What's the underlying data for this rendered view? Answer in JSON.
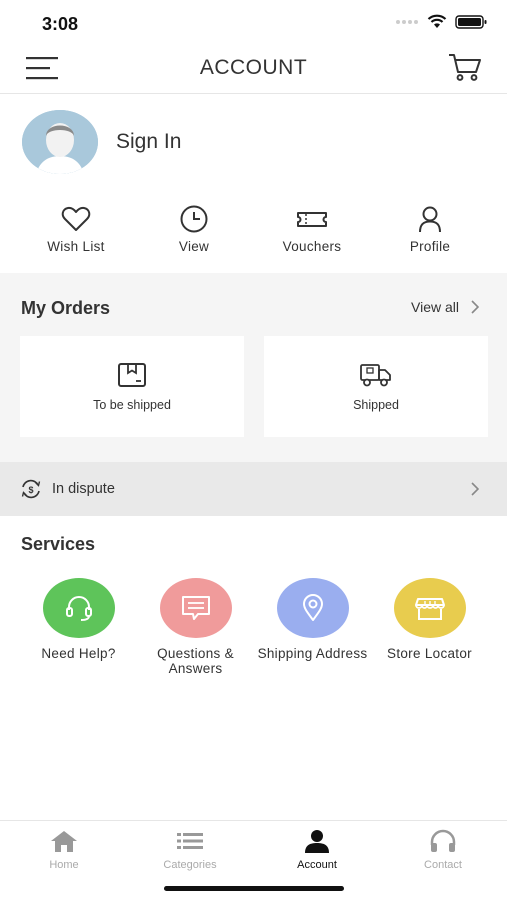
{
  "status_bar": {
    "time": "3:08"
  },
  "header": {
    "title": "ACCOUNT"
  },
  "profile": {
    "sign_in_label": "Sign In"
  },
  "quick_actions": [
    {
      "label": "Wish List",
      "icon": "heart-icon"
    },
    {
      "label": "View",
      "icon": "clock-icon"
    },
    {
      "label": "Vouchers",
      "icon": "ticket-icon"
    },
    {
      "label": "Profile",
      "icon": "person-icon"
    }
  ],
  "orders": {
    "title": "My Orders",
    "view_all": "View all",
    "cards": [
      {
        "label": "To be shipped",
        "icon": "box-icon"
      },
      {
        "label": "Shipped",
        "icon": "truck-icon"
      }
    ],
    "dispute_label": "In dispute"
  },
  "services": {
    "title": "Services",
    "items": [
      {
        "label": "Need Help?",
        "icon": "headset-icon",
        "color": "#5ec45a"
      },
      {
        "label": "Questions & Answers",
        "icon": "message-icon",
        "color": "#f09b9b"
      },
      {
        "label": "Shipping Address",
        "icon": "location-pin-icon",
        "color": "#9aaeef"
      },
      {
        "label": "Store Locator",
        "icon": "store-icon",
        "color": "#e8cc4e"
      }
    ]
  },
  "tabbar": {
    "active_tab": "Account",
    "tabs": [
      {
        "label": "Home",
        "icon": "home-icon"
      },
      {
        "label": "Categories",
        "icon": "list-icon"
      },
      {
        "label": "Account",
        "icon": "person-icon"
      },
      {
        "label": "Contact",
        "icon": "headphones-icon"
      }
    ]
  }
}
